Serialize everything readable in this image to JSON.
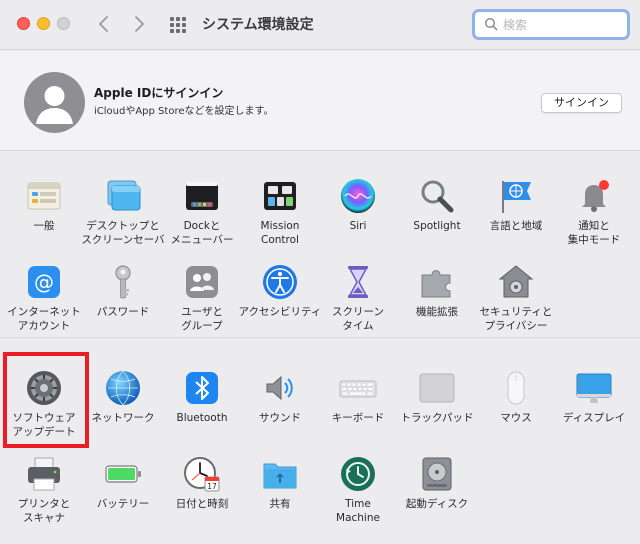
{
  "window": {
    "title": "システム環境設定",
    "search_placeholder": "検索"
  },
  "apple_id": {
    "title": "Apple IDにサインイン",
    "subtitle": "iCloudやApp Storeなどを設定します。",
    "signin_label": "サインイン"
  },
  "rows": [
    [
      {
        "label": "一般",
        "icon": "general-icon"
      },
      {
        "label": "デスクトップと\nスクリーンセーバ",
        "icon": "desktop-icon"
      },
      {
        "label": "Dockと\nメニューバー",
        "icon": "dock-icon"
      },
      {
        "label": "Mission\nControl",
        "icon": "mission-control-icon"
      },
      {
        "label": "Siri",
        "icon": "siri-icon"
      },
      {
        "label": "Spotlight",
        "icon": "spotlight-icon"
      },
      {
        "label": "言語と地域",
        "icon": "language-region-icon"
      },
      {
        "label": "通知と\n集中モード",
        "icon": "notifications-icon"
      }
    ],
    [
      {
        "label": "インターネット\nアカウント",
        "icon": "internet-accounts-icon"
      },
      {
        "label": "パスワード",
        "icon": "passwords-icon"
      },
      {
        "label": "ユーザと\nグループ",
        "icon": "users-groups-icon"
      },
      {
        "label": "アクセシビリティ",
        "icon": "accessibility-icon"
      },
      {
        "label": "スクリーン\nタイム",
        "icon": "screen-time-icon"
      },
      {
        "label": "機能拡張",
        "icon": "extensions-icon"
      },
      {
        "label": "セキュリティと\nプライバシー",
        "icon": "security-icon"
      }
    ],
    [
      {
        "label": "ソフトウェア\nアップデート",
        "icon": "software-update-icon"
      },
      {
        "label": "ネットワーク",
        "icon": "network-icon"
      },
      {
        "label": "Bluetooth",
        "icon": "bluetooth-icon"
      },
      {
        "label": "サウンド",
        "icon": "sound-icon"
      },
      {
        "label": "キーボード",
        "icon": "keyboard-icon"
      },
      {
        "label": "トラックパッド",
        "icon": "trackpad-icon"
      },
      {
        "label": "マウス",
        "icon": "mouse-icon"
      },
      {
        "label": "ディスプレイ",
        "icon": "displays-icon"
      }
    ],
    [
      {
        "label": "プリンタと\nスキャナ",
        "icon": "printers-icon"
      },
      {
        "label": "バッテリー",
        "icon": "battery-icon"
      },
      {
        "label": "日付と時刻",
        "icon": "date-time-icon"
      },
      {
        "label": "共有",
        "icon": "sharing-icon"
      },
      {
        "label": "Time\nMachine",
        "icon": "time-machine-icon"
      },
      {
        "label": "起動ディスク",
        "icon": "startup-disk-icon"
      }
    ]
  ],
  "calendar_day": "17",
  "highlight_color": "#ea1c25"
}
